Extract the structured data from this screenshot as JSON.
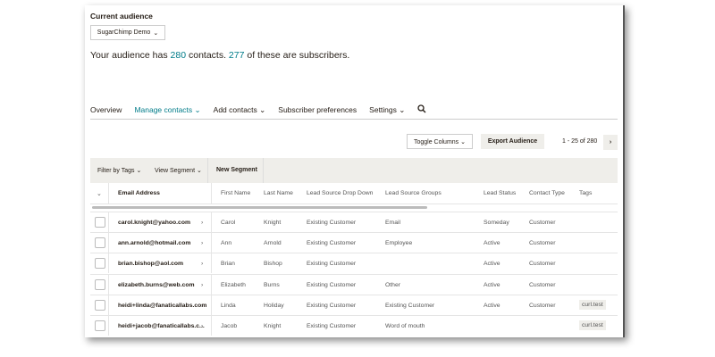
{
  "header": {
    "label": "Current audience",
    "audience": "SugarChimp Demo",
    "summary_pre": "Your audience has ",
    "contacts": "280",
    "summary_mid": " contacts. ",
    "subscribers": "277",
    "summary_post": " of these are subscribers."
  },
  "nav": {
    "items": [
      "Overview",
      "Manage contacts ⌄",
      "Add contacts ⌄",
      "Subscriber preferences",
      "Settings ⌄"
    ]
  },
  "toolbar": {
    "toggle": "Toggle Columns ⌄",
    "export": "Export Audience",
    "pagination": "1 - 25 of 280",
    "next": "›"
  },
  "filters": {
    "tags": "Filter by Tags ⌄",
    "segment": "View Segment ⌄",
    "new_segment": "New Segment"
  },
  "table": {
    "columns": [
      "Email Address",
      "First Name",
      "Last Name",
      "Lead Source Drop Down",
      "Lead Source Groups",
      "Lead Status",
      "Contact Type",
      "Tags"
    ],
    "rows": [
      [
        "carol.knight@yahoo.com",
        "Carol",
        "Knight",
        "Existing Customer",
        "Email",
        "Someday",
        "Customer",
        ""
      ],
      [
        "ann.arnold@hotmail.com",
        "Ann",
        "Arnold",
        "Existing Customer",
        "Employee",
        "Active",
        "Customer",
        ""
      ],
      [
        "brian.bishop@aol.com",
        "Brian",
        "Bishop",
        "Existing Customer",
        "",
        "Active",
        "Customer",
        ""
      ],
      [
        "elizabeth.burns@web.com",
        "Elizabeth",
        "Burns",
        "Existing Customer",
        "Other",
        "Active",
        "Customer",
        ""
      ],
      [
        "heidi+linda@fanaticallabs.com",
        "Linda",
        "Holiday",
        "Existing Customer",
        "Existing Customer",
        "Active",
        "Customer",
        "curl.test"
      ],
      [
        "heidi+jacob@fanaticallabs.c...",
        "Jacob",
        "Knight",
        "Existing Customer",
        "Word of mouth",
        "",
        "",
        "curl.test"
      ]
    ]
  }
}
